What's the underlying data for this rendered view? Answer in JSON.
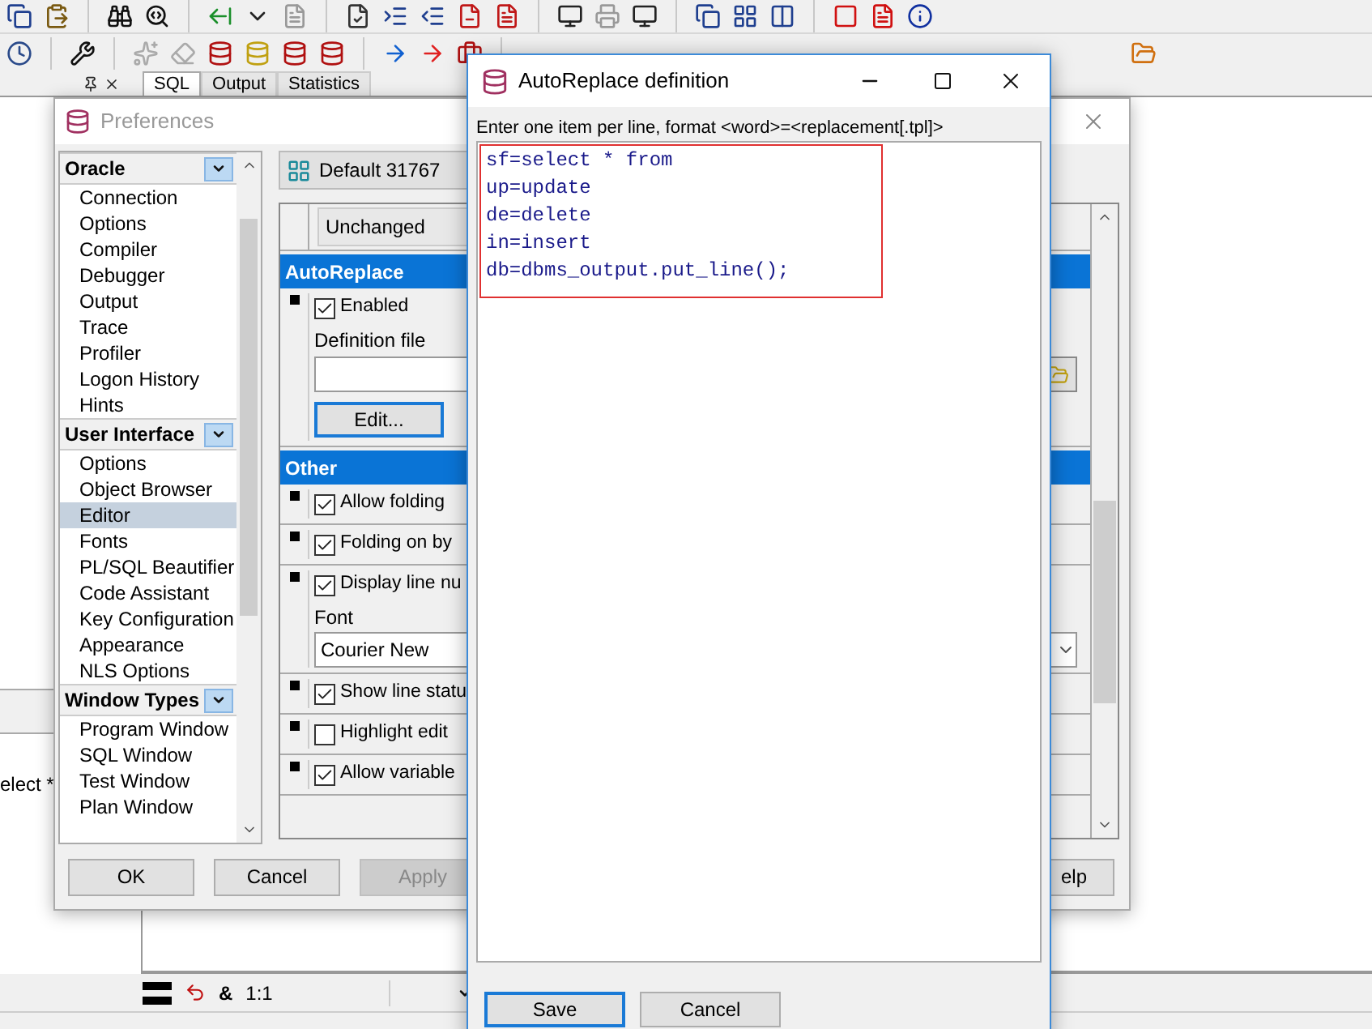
{
  "ide": {
    "panel_tabs": [
      {
        "label": "SQL",
        "selected": true
      },
      {
        "label": "Output",
        "selected": false
      },
      {
        "label": "Statistics",
        "selected": false
      }
    ],
    "editor_snippet": "elect *",
    "status_bar": {
      "symbol": "&",
      "position": "1:1"
    }
  },
  "preferences": {
    "title": "Preferences",
    "sidebar": [
      {
        "heading": "Oracle",
        "items": [
          {
            "label": "Connection",
            "selected": false
          },
          {
            "label": "Options",
            "selected": false
          },
          {
            "label": "Compiler",
            "selected": false
          },
          {
            "label": "Debugger",
            "selected": false
          },
          {
            "label": "Output",
            "selected": false
          },
          {
            "label": "Trace",
            "selected": false
          },
          {
            "label": "Profiler",
            "selected": false
          },
          {
            "label": "Logon History",
            "selected": false
          },
          {
            "label": "Hints",
            "selected": false
          }
        ]
      },
      {
        "heading": "User Interface",
        "items": [
          {
            "label": "Options",
            "selected": false
          },
          {
            "label": "Object Browser",
            "selected": false
          },
          {
            "label": "Editor",
            "selected": true
          },
          {
            "label": "Fonts",
            "selected": false
          },
          {
            "label": "PL/SQL Beautifier",
            "selected": false
          },
          {
            "label": "Code Assistant",
            "selected": false
          },
          {
            "label": "Key Configuration",
            "selected": false
          },
          {
            "label": "Appearance",
            "selected": false
          },
          {
            "label": "NLS Options",
            "selected": false
          }
        ]
      },
      {
        "heading": "Window Types",
        "items": [
          {
            "label": "Program Window",
            "selected": false
          },
          {
            "label": "SQL Window",
            "selected": false
          },
          {
            "label": "Test Window",
            "selected": false
          },
          {
            "label": "Plan Window",
            "selected": false
          }
        ]
      }
    ],
    "profile_button": "Default 31767",
    "scheme_value": "Unchanged",
    "sections": [
      {
        "title": "AutoReplace",
        "blocks": [
          {
            "items": [
              {
                "kind": "checkbox",
                "label": "Enabled",
                "checked": true
              },
              {
                "kind": "file",
                "label": "Definition file"
              },
              {
                "kind": "button",
                "label": "Edit..."
              }
            ]
          }
        ]
      },
      {
        "title": "Other",
        "blocks": [
          {
            "items": [
              {
                "kind": "checkbox",
                "label": "Allow folding",
                "checked": true
              }
            ]
          },
          {
            "items": [
              {
                "kind": "checkbox",
                "label": "Folding on by",
                "checked": true
              }
            ]
          },
          {
            "items": [
              {
                "kind": "checkbox",
                "label": "Display line nu",
                "checked": true
              },
              {
                "kind": "select",
                "label": "Font",
                "value": "Courier New"
              }
            ]
          },
          {
            "items": [
              {
                "kind": "checkbox",
                "label": "Show line statu",
                "checked": true
              }
            ]
          },
          {
            "items": [
              {
                "kind": "checkbox",
                "label": "Highlight edit",
                "checked": false
              }
            ]
          },
          {
            "items": [
              {
                "kind": "checkbox",
                "label": "Allow variable",
                "checked": true
              }
            ]
          }
        ]
      }
    ],
    "buttons": [
      {
        "label": "OK",
        "disabled": false
      },
      {
        "label": "Cancel",
        "disabled": false
      },
      {
        "label": "Apply",
        "disabled": true
      }
    ],
    "help_button": "elp"
  },
  "dialog": {
    "title": "AutoReplace definition",
    "instruction": "Enter one item per line, format <word>=<replacement[.tpl]>",
    "lines": [
      "sf=select * from",
      "up=update",
      "de=delete",
      "in=insert",
      "db=dbms_output.put_line();"
    ],
    "buttons": [
      {
        "label": "Save",
        "focused": true
      },
      {
        "label": "Cancel",
        "focused": false
      }
    ]
  }
}
